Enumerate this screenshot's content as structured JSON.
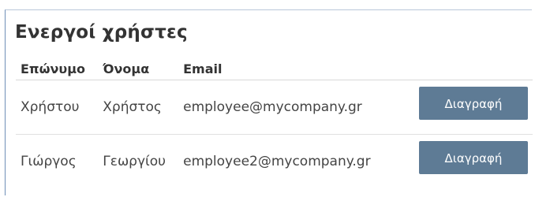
{
  "panel": {
    "title": "Ενεργοί χρήστες"
  },
  "table": {
    "headers": {
      "last_name": "Επώνυμο",
      "first_name": "Όνομα",
      "email": "Email",
      "action": ""
    },
    "rows": [
      {
        "last_name": "Χρήστου",
        "first_name": "Χρήστος",
        "email": "employee@mycompany.gr",
        "action_label": "Διαγραφή"
      },
      {
        "last_name": "Γιώργος",
        "first_name": "Γεωργίου",
        "email": "employee2@mycompany.gr",
        "action_label": "Διαγραφή"
      }
    ]
  },
  "colors": {
    "button_bg": "#5e7b95",
    "button_text": "#ffffff",
    "panel_border": "#6f8fb8"
  }
}
